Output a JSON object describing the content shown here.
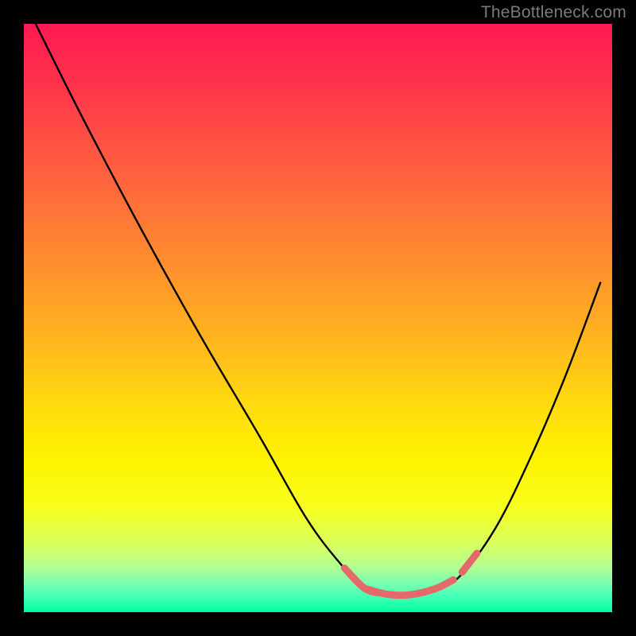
{
  "watermark": "TheBottleneck.com",
  "chart_data": {
    "type": "line",
    "title": "",
    "xlabel": "",
    "ylabel": "",
    "xlim": [
      0,
      100
    ],
    "ylim": [
      0,
      100
    ],
    "grid": false,
    "series": [
      {
        "name": "bottleneck-curve",
        "color": "#000000",
        "x": [
          2,
          10,
          20,
          30,
          40,
          48,
          54,
          58,
          62,
          66,
          70,
          74,
          80,
          86,
          92,
          98
        ],
        "y": [
          100,
          84,
          65,
          47,
          30,
          16,
          8,
          4,
          3,
          3,
          4,
          6,
          14,
          26,
          40,
          56
        ]
      }
    ],
    "segments": [
      {
        "name": "highlight-left",
        "color": "#e46a6a",
        "x": [
          54.5,
          58,
          61
        ],
        "y": [
          7.5,
          4,
          3.2
        ]
      },
      {
        "name": "highlight-bottom",
        "color": "#e46a6a",
        "x": [
          58,
          62,
          66,
          70,
          73
        ],
        "y": [
          4,
          3,
          3,
          4,
          5.5
        ]
      },
      {
        "name": "highlight-right",
        "color": "#e46a6a",
        "x": [
          74.5,
          77
        ],
        "y": [
          6.8,
          10
        ]
      }
    ],
    "colors": {
      "gradient_top": "#ff1a52",
      "gradient_mid": "#fff300",
      "gradient_bottom": "#00ff9a",
      "curve": "#000000",
      "highlight": "#e46a6a",
      "watermark": "#7a7a7a",
      "background": "#000000"
    }
  }
}
